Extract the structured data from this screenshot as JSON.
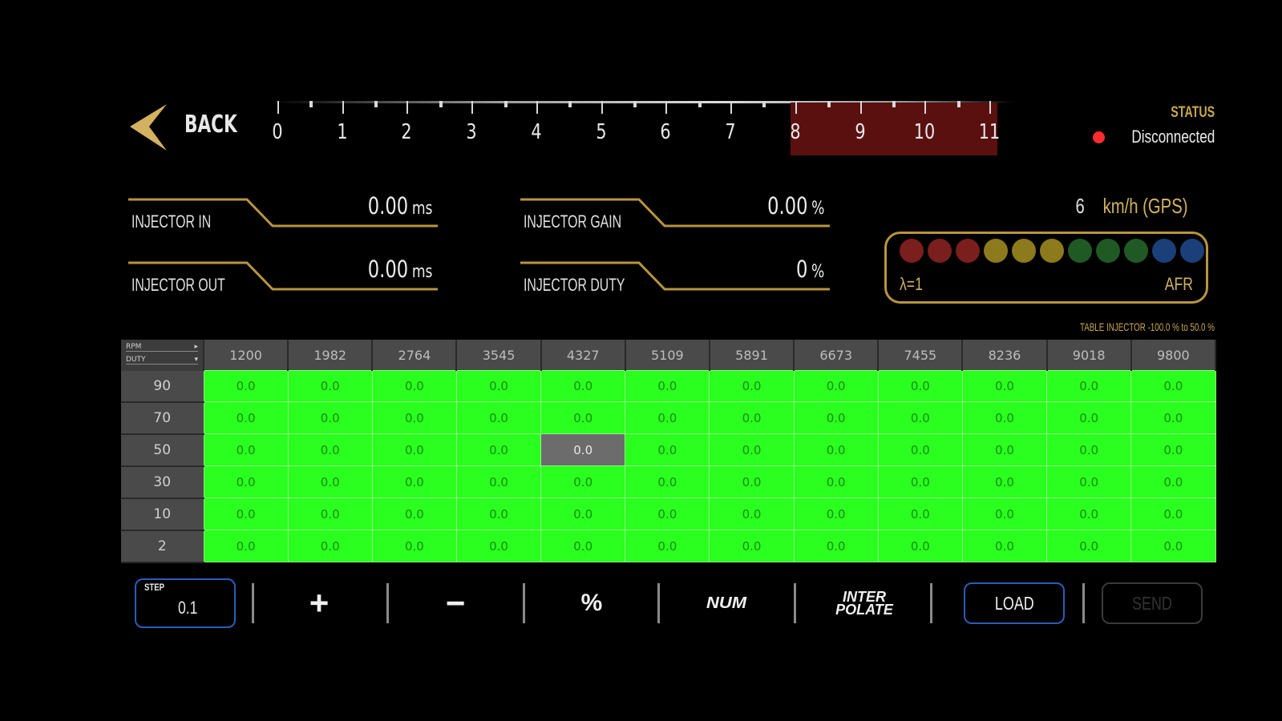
{
  "header": {
    "back_label": "BACK",
    "status_label": "STATUS",
    "status_value": "Disconnected"
  },
  "gauge": {
    "ticks": [
      "0",
      "1",
      "2",
      "3",
      "4",
      "5",
      "6",
      "7",
      "8",
      "9",
      "10",
      "11"
    ],
    "redline_start": 8,
    "max": 11
  },
  "readouts": {
    "injector_in": {
      "label": "INJECTOR IN",
      "value": "0.00",
      "unit": "ms"
    },
    "injector_out": {
      "label": "INJECTOR OUT",
      "value": "0.00",
      "unit": "ms"
    },
    "injector_gain": {
      "label": "INJECTOR GAIN",
      "value": "0.00",
      "unit": "%"
    },
    "injector_duty": {
      "label": "INJECTOR DUTY",
      "value": "0",
      "unit": "%"
    }
  },
  "speed": {
    "value": "6",
    "unit": "km/h (GPS)"
  },
  "afr": {
    "left_label": "λ=1",
    "right_label": "AFR",
    "dot_colors": [
      "#7a1e1e",
      "#7a1e1e",
      "#7a1e1e",
      "#8c7a1c",
      "#8c7a1c",
      "#8c7a1c",
      "#1f5a24",
      "#1f5a24",
      "#1f5a24",
      "#1b3f78",
      "#1b3f78"
    ]
  },
  "table": {
    "title": "TABLE INJECTOR -100.0 % to 50.0 %",
    "corner_top": "RPM",
    "corner_bottom": "DUTY",
    "columns": [
      "1200",
      "1982",
      "2764",
      "3545",
      "4327",
      "5109",
      "5891",
      "6673",
      "7455",
      "8236",
      "9018",
      "9800"
    ],
    "rows": [
      {
        "label": "90",
        "values": [
          "0.0",
          "0.0",
          "0.0",
          "0.0",
          "0.0",
          "0.0",
          "0.0",
          "0.0",
          "0.0",
          "0.0",
          "0.0",
          "0.0"
        ]
      },
      {
        "label": "70",
        "values": [
          "0.0",
          "0.0",
          "0.0",
          "0.0",
          "0.0",
          "0.0",
          "0.0",
          "0.0",
          "0.0",
          "0.0",
          "0.0",
          "0.0"
        ]
      },
      {
        "label": "50",
        "values": [
          "0.0",
          "0.0",
          "0.0",
          "0.0",
          "0.0",
          "0.0",
          "0.0",
          "0.0",
          "0.0",
          "0.0",
          "0.0",
          "0.0"
        ]
      },
      {
        "label": "30",
        "values": [
          "0.0",
          "0.0",
          "0.0",
          "0.0",
          "0.0",
          "0.0",
          "0.0",
          "0.0",
          "0.0",
          "0.0",
          "0.0",
          "0.0"
        ]
      },
      {
        "label": "10",
        "values": [
          "0.0",
          "0.0",
          "0.0",
          "0.0",
          "0.0",
          "0.0",
          "0.0",
          "0.0",
          "0.0",
          "0.0",
          "0.0",
          "0.0"
        ]
      },
      {
        "label": "2",
        "values": [
          "0.0",
          "0.0",
          "0.0",
          "0.0",
          "0.0",
          "0.0",
          "0.0",
          "0.0",
          "0.0",
          "0.0",
          "0.0",
          "0.0"
        ]
      }
    ],
    "selected": {
      "row": 2,
      "col": 4
    }
  },
  "toolbar": {
    "step_label": "STEP",
    "step_value": "0.1",
    "plus_label": "+",
    "minus_label": "−",
    "percent_label": "%",
    "num_label": "NUM",
    "interpolate_line1": "INTER",
    "interpolate_line2": "POLATE",
    "load_label": "LOAD",
    "send_label": "SEND"
  },
  "colors": {
    "accent_gold": "#c9a84c",
    "table_green": "#2bff1f",
    "button_blue": "#2a5cb8",
    "status_red": "#ff2d2d",
    "redline": "#5b1010"
  }
}
